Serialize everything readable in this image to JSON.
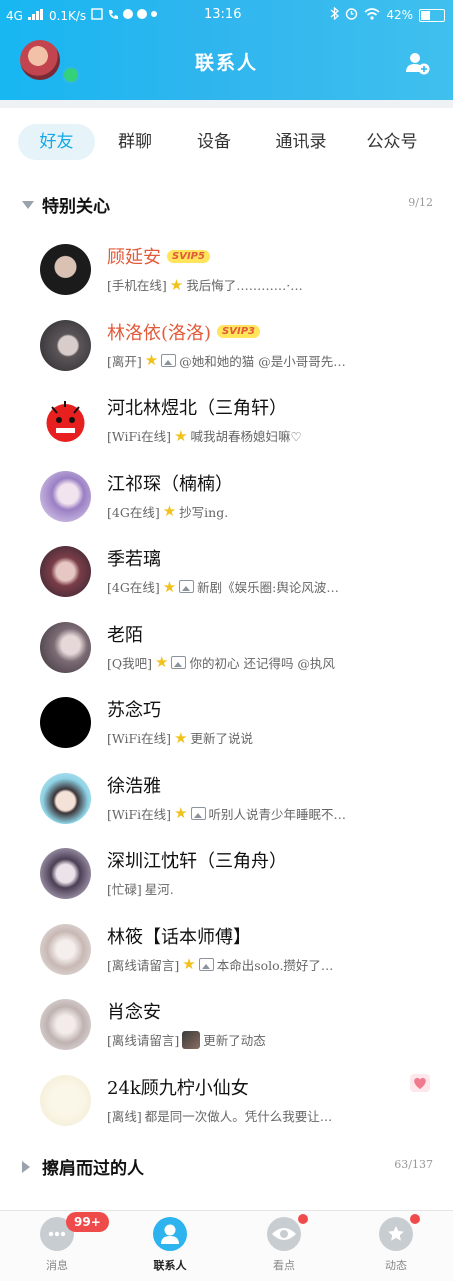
{
  "status_bar": {
    "network": "4G",
    "speed": "0.1K/s",
    "time": "13:16",
    "battery": "42%"
  },
  "header": {
    "title": "联系人"
  },
  "tabs": [
    {
      "label": "好友"
    },
    {
      "label": "群聊"
    },
    {
      "label": "设备"
    },
    {
      "label": "通讯录"
    },
    {
      "label": "公众号"
    }
  ],
  "groups": {
    "special": {
      "name": "特别关心",
      "count": "9/12"
    },
    "passing": {
      "name": "擦肩而过的人",
      "count": "63/137"
    }
  },
  "contacts": [
    {
      "name": "顾延安",
      "vip": "SVIP5",
      "status": "[手机在线]",
      "msg": "我后悔了…………·…"
    },
    {
      "name": "林洛依(洛洛)",
      "vip": "SVIP3",
      "status": "[离开]",
      "msg": "@她和她的猫 @是小哥哥先…"
    },
    {
      "name": "河北林煜北（三角轩）",
      "status": "[WiFi在线]",
      "msg": "喊我胡春杨媳妇嘛♡"
    },
    {
      "name": "江祁琛（楠楠）",
      "status": "[4G在线]",
      "msg": "抄写ing."
    },
    {
      "name": "季若璃",
      "status": "[4G在线]",
      "msg": "新剧《娱乐圈:舆论风波…"
    },
    {
      "name": "老陌",
      "status": "[Q我吧]",
      "msg": "你的初心 还记得吗 @执风"
    },
    {
      "name": "苏念巧",
      "status": "[WiFi在线]",
      "msg": "更新了说说"
    },
    {
      "name": "徐浩雅",
      "status": "[WiFi在线]",
      "msg": "听别人说青少年睡眠不…"
    },
    {
      "name": "深圳江忱轩（三角舟）",
      "status": "[忙碌]",
      "msg": "星河."
    },
    {
      "name": "林筱【话本师傅】",
      "status": "[离线请留言]",
      "msg": "本命出solo.攒好了…"
    },
    {
      "name": "肖念安",
      "status": "[离线请留言]",
      "msg": "更新了动态"
    },
    {
      "name": "24k顾九柠小仙女",
      "status": "[离线]",
      "msg": "都是同一次做人。凭什么我要让…"
    }
  ],
  "bottom_nav": [
    {
      "label": "消息",
      "badge": "99+"
    },
    {
      "label": "联系人"
    },
    {
      "label": "看点"
    },
    {
      "label": "动态"
    }
  ],
  "colors": {
    "header_blue": "#2fb5ee",
    "accent": "#12a9e6",
    "vip_name": "#e25a3a",
    "badge_red": "#f04b4b"
  }
}
